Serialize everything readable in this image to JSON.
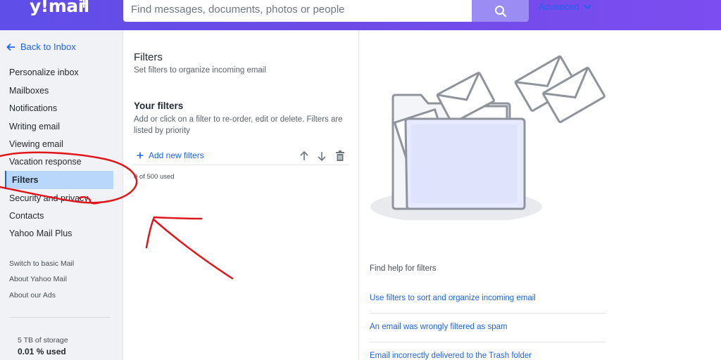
{
  "header": {
    "logo_text": "y!mail",
    "logo_plus": "+",
    "search_placeholder": "Find messages, documents, photos or people",
    "advanced_label": "Advanced"
  },
  "sidebar": {
    "back_label": "Back to Inbox",
    "items": [
      {
        "label": "Personalize inbox"
      },
      {
        "label": "Mailboxes"
      },
      {
        "label": "Notifications"
      },
      {
        "label": "Writing email"
      },
      {
        "label": "Viewing email"
      },
      {
        "label": "Vacation response"
      },
      {
        "label": "Filters",
        "active": true
      },
      {
        "label": "Security and privacy"
      },
      {
        "label": "Contacts"
      },
      {
        "label": "Yahoo Mail Plus"
      }
    ],
    "small_links": [
      {
        "label": "Switch to basic Mail"
      },
      {
        "label": "About Yahoo Mail"
      },
      {
        "label": "About our Ads"
      }
    ],
    "storage_label": "5 TB of storage",
    "storage_used": "0.01 % used"
  },
  "filters": {
    "title": "Filters",
    "subtitle": "Set filters to organize incoming email",
    "your_filters_title": "Your filters",
    "your_filters_desc": "Add or click on a filter to re-order, edit or delete. Filters are listed by priority",
    "add_label": "Add new filters",
    "used_text": "0 of 500 used"
  },
  "help": {
    "title": "Find help for filters",
    "links": [
      {
        "label": "Use filters to sort and organize incoming email"
      },
      {
        "label": "An email was wrongly filtered as spam"
      },
      {
        "label": "Email incorrectly delivered to the Trash folder"
      }
    ]
  },
  "colors": {
    "header_gradient_start": "#5f4ee8",
    "header_gradient_end": "#7c4df0",
    "link_blue": "#1d63ed",
    "active_item_bg": "#b8d7fb",
    "annotation_red": "#e0161b"
  },
  "icons": {
    "search": "search-icon",
    "back": "arrow-left-icon",
    "advanced": "chevron-down-icon",
    "add": "plus-icon",
    "move_up": "arrow-up-icon",
    "move_down": "arrow-down-icon",
    "delete": "trash-icon"
  }
}
